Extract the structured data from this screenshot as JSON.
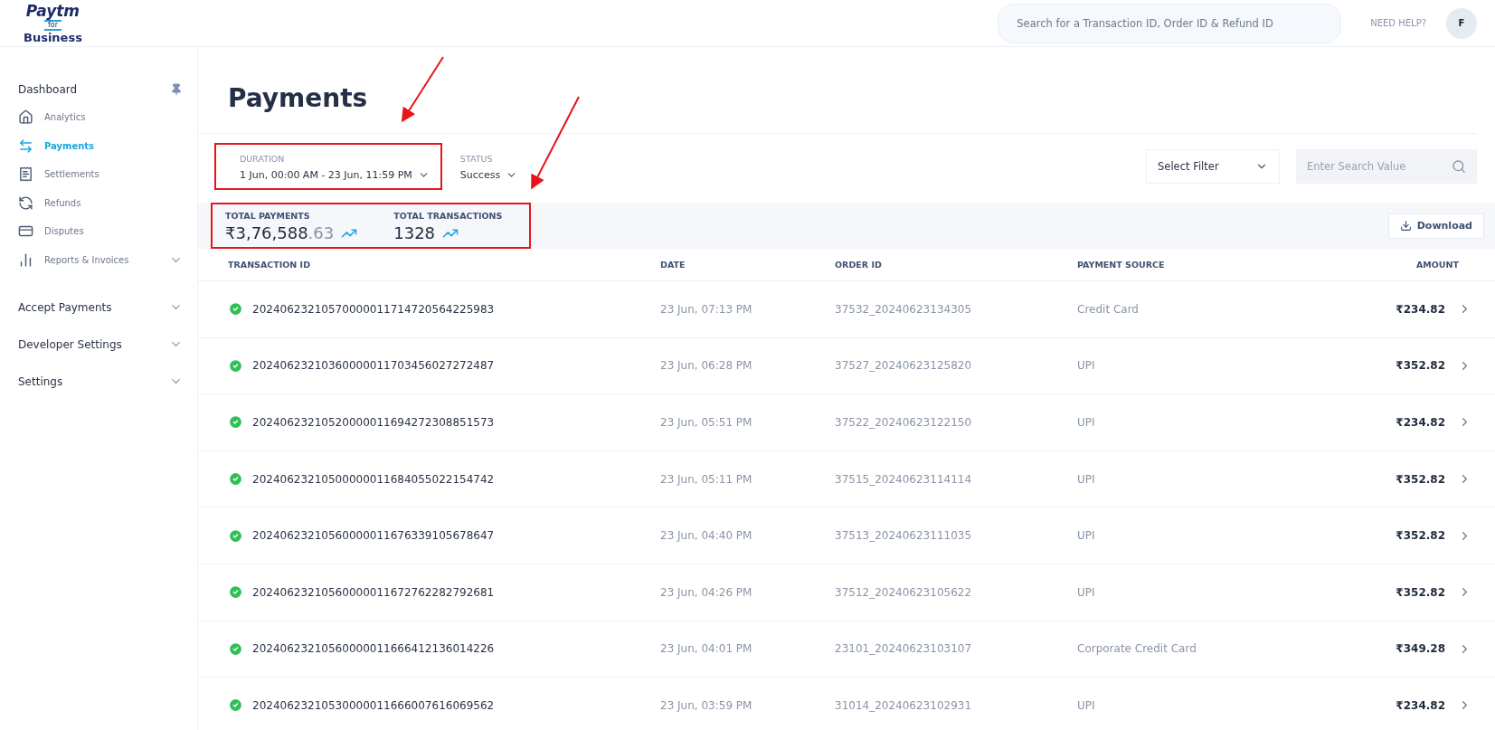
{
  "header": {
    "logo_top": "Paytm",
    "logo_for": "for",
    "logo_bottom": "Business",
    "search": {
      "placeholder": "Search for a Transaction ID, Order ID & Refund ID"
    },
    "help": "NEED HELP?",
    "avatar": "F"
  },
  "sidebar": {
    "title": "Dashboard",
    "items": [
      {
        "label": "Analytics",
        "selected": false
      },
      {
        "label": "Payments",
        "selected": true
      },
      {
        "label": "Settlements",
        "selected": false
      },
      {
        "label": "Refunds",
        "selected": false
      },
      {
        "label": "Disputes",
        "selected": false
      },
      {
        "label": "Reports & Invoices",
        "selected": false,
        "expanded": false
      }
    ],
    "sections": [
      {
        "label": "Accept Payments",
        "expanded": false
      },
      {
        "label": "Developer Settings",
        "expanded": false
      },
      {
        "label": "Settings",
        "expanded": false
      }
    ]
  },
  "page_title": "Payments",
  "filters": [
    {
      "label": "DURATION",
      "value": "1 Jun, 00:00 AM - 23 Jun, 11:59 PM",
      "highlighted": true
    },
    {
      "label": "STATUS",
      "value": "Success",
      "highlighted": false
    }
  ],
  "filter_select": "Select Filter",
  "search_value": {
    "placeholder": "Enter Search Value"
  },
  "totals": {
    "highlighted": true,
    "items": [
      {
        "label": "TOTAL PAYMENTS",
        "value": "₹3,76,588",
        "decimals": ".63"
      },
      {
        "label": "TOTAL TRANSACTIONS",
        "value": "1328"
      }
    ]
  },
  "download": "Download",
  "table": {
    "columns": [
      "TRANSACTION ID",
      "DATE",
      "ORDER ID",
      "PAYMENT SOURCE",
      "AMOUNT"
    ],
    "rows": [
      {
        "succeeded": true,
        "id": "20240623210570000011714720564225983",
        "date": "23 Jun, 07:13 PM",
        "order": "37532_20240623134305",
        "source": "Credit Card",
        "amount": "₹234.82"
      },
      {
        "succeeded": true,
        "id": "20240623210360000011703456027272487",
        "date": "23 Jun, 06:28 PM",
        "order": "37527_20240623125820",
        "source": "UPI",
        "amount": "₹352.82"
      },
      {
        "succeeded": true,
        "id": "20240623210520000011694272308851573",
        "date": "23 Jun, 05:51 PM",
        "order": "37522_20240623122150",
        "source": "UPI",
        "amount": "₹234.82"
      },
      {
        "succeeded": true,
        "id": "20240623210500000011684055022154742",
        "date": "23 Jun, 05:11 PM",
        "order": "37515_20240623114114",
        "source": "UPI",
        "amount": "₹352.82"
      },
      {
        "succeeded": true,
        "id": "20240623210560000011676339105678647",
        "date": "23 Jun, 04:40 PM",
        "order": "37513_20240623111035",
        "source": "UPI",
        "amount": "₹352.82"
      },
      {
        "succeeded": true,
        "id": "20240623210560000011672762282792681",
        "date": "23 Jun, 04:26 PM",
        "order": "37512_20240623105622",
        "source": "UPI",
        "amount": "₹352.82"
      },
      {
        "succeeded": true,
        "id": "20240623210560000011666412136014226",
        "date": "23 Jun, 04:01 PM",
        "order": "23101_20240623103107",
        "source": "Corporate Credit Card",
        "amount": "₹349.28"
      },
      {
        "succeeded": true,
        "id": "20240623210530000011666007616069562",
        "date": "23 Jun, 03:59 PM",
        "order": "31014_20240623102931",
        "source": "UPI",
        "amount": "₹234.82"
      }
    ]
  }
}
